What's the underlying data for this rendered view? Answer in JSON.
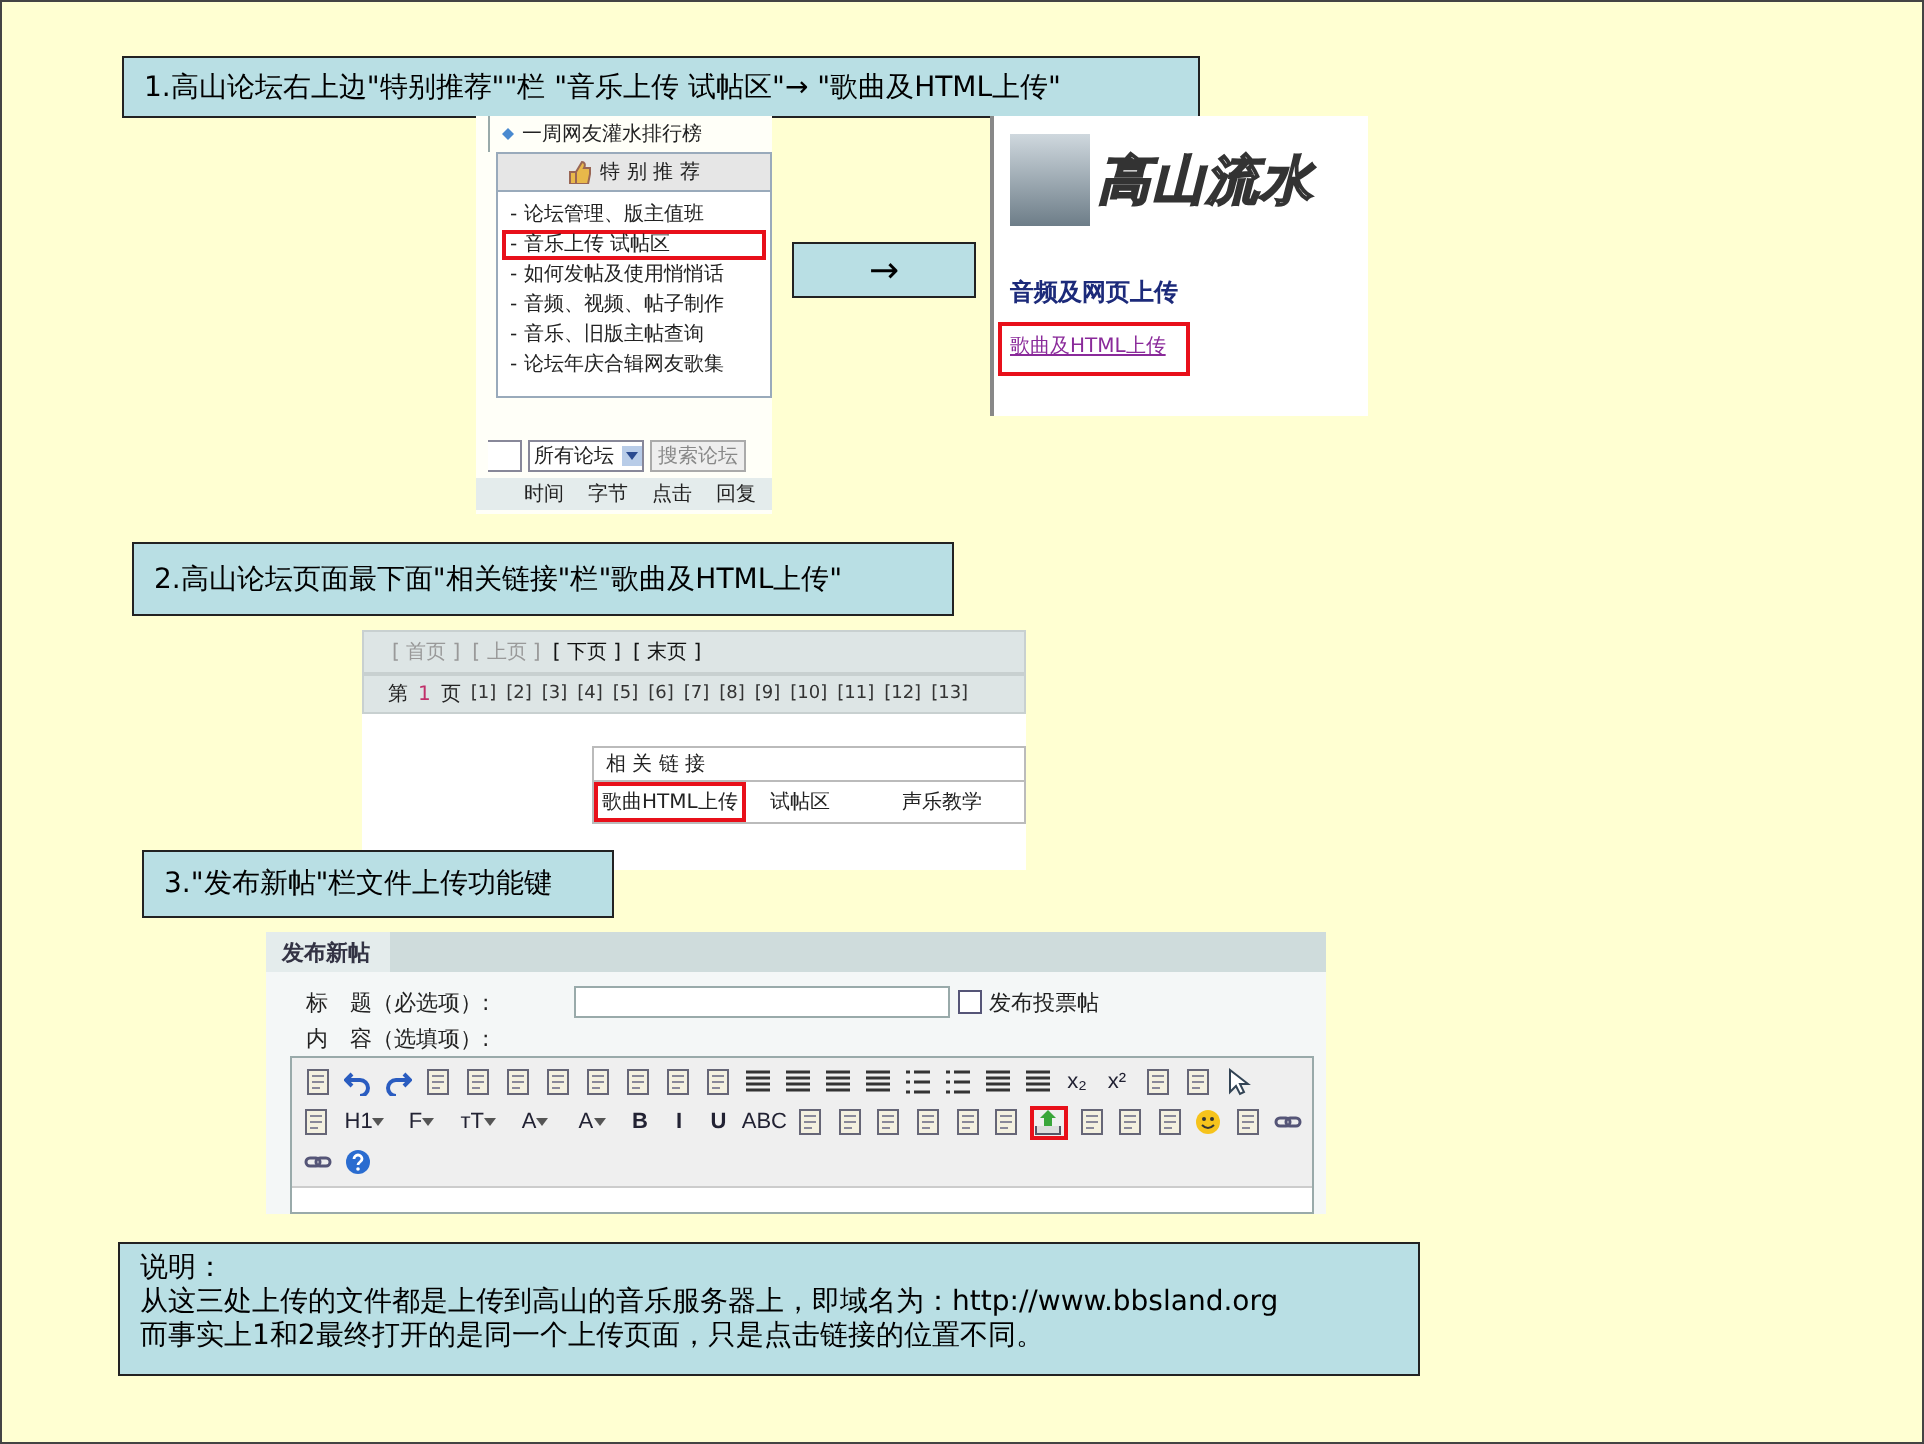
{
  "step_1": {
    "label": "1.高山论坛右上边\"特别推荐\"\"栏 \"音乐上传  试帖区\"→ \"歌曲及HTML上传\""
  },
  "forum_sidebar": {
    "top_item": "一周网友灌水排行榜",
    "panel_title": "特 别 推 荐",
    "links": [
      {
        "label": "- 论坛管理、版主值班",
        "highlighted": false
      },
      {
        "label": "- 音乐上传   试帖区",
        "highlighted": true
      },
      {
        "label": "- 如何发帖及使用悄悄话",
        "highlighted": false
      },
      {
        "label": "- 音频、视频、帖子制作",
        "highlighted": false
      },
      {
        "label": "- 音乐、旧版主帖查询",
        "highlighted": false
      },
      {
        "label": "- 论坛年庆合辑网友歌集",
        "highlighted": false
      }
    ],
    "scope_select": "所有论坛",
    "search_button": "搜索论坛",
    "columns": [
      "时间",
      "字节",
      "点击",
      "回复"
    ]
  },
  "arrow_box": {
    "label": "→"
  },
  "upload_page": {
    "logo": "高山流水",
    "heading": "音频及网页上传",
    "link": {
      "label": "歌曲及HTML上传",
      "highlighted": true
    }
  },
  "step_2": {
    "label": "2.高山论坛页面最下面\"相关链接\"栏\"歌曲及HTML上传\""
  },
  "forum_footer": {
    "nav": [
      {
        "label": "[ 首页 ]",
        "disabled": true
      },
      {
        "label": "[ 上页 ]",
        "disabled": true
      },
      {
        "label": "[ 下页 ]",
        "disabled": false
      },
      {
        "label": "[ 末页 ]",
        "disabled": false
      }
    ],
    "page_prefix": "第",
    "current_page": "1",
    "page_suffix": "页",
    "pages": [
      "[1]",
      "[2]",
      "[3]",
      "[4]",
      "[5]",
      "[6]",
      "[7]",
      "[8]",
      "[9]",
      "[10]",
      "[11]",
      "[12]",
      "[13]"
    ],
    "related_title": "相 关 链 接",
    "related_links": [
      {
        "label": "歌曲HTML上传",
        "highlighted": true
      },
      {
        "label": "试帖区",
        "highlighted": false
      },
      {
        "label": "声乐教学",
        "highlighted": false
      }
    ]
  },
  "step_3": {
    "label": "3.\"发布新帖\"栏文件上传功能键"
  },
  "new_post": {
    "tab": "发布新帖",
    "title_label": "标　题（必选项）:",
    "poll_checkbox": {
      "label": "发布投票帖",
      "checked": false
    },
    "content_label": "内　容（选填项）:",
    "toolbar_rows": [
      [
        {
          "kind": "icon",
          "highlighted": false
        },
        {
          "kind": "undo",
          "highlighted": false
        },
        {
          "kind": "redo",
          "highlighted": false
        },
        {
          "kind": "icon",
          "highlighted": false
        },
        {
          "kind": "icon",
          "highlighted": false
        },
        {
          "kind": "icon",
          "highlighted": false
        },
        {
          "kind": "icon",
          "highlighted": false
        },
        {
          "kind": "icon",
          "highlighted": false
        },
        {
          "kind": "icon",
          "highlighted": false
        },
        {
          "kind": "icon",
          "highlighted": false
        },
        {
          "kind": "icon",
          "highlighted": false
        },
        {
          "kind": "align",
          "highlighted": false
        },
        {
          "kind": "align",
          "highlighted": false
        },
        {
          "kind": "align",
          "highlighted": false
        },
        {
          "kind": "align",
          "highlighted": false
        },
        {
          "kind": "list",
          "highlighted": false
        },
        {
          "kind": "list",
          "highlighted": false
        },
        {
          "kind": "align",
          "highlighted": false
        },
        {
          "kind": "align",
          "highlighted": false
        },
        {
          "kind": "text",
          "label": "x₂",
          "highlighted": false
        },
        {
          "kind": "text",
          "label": "x²",
          "highlighted": false
        },
        {
          "kind": "icon",
          "highlighted": false
        },
        {
          "kind": "icon",
          "highlighted": false
        },
        {
          "kind": "pointer",
          "highlighted": false
        }
      ],
      [
        {
          "kind": "icon",
          "highlighted": false
        },
        {
          "kind": "menu",
          "label": "H1",
          "highlighted": false
        },
        {
          "kind": "menu",
          "label": "F",
          "highlighted": false
        },
        {
          "kind": "menu",
          "label": "тT",
          "highlighted": false
        },
        {
          "kind": "menu",
          "label": "A",
          "highlighted": false
        },
        {
          "kind": "menu",
          "label": "A",
          "highlighted": false
        },
        {
          "kind": "text",
          "label": "B",
          "highlighted": false
        },
        {
          "kind": "text",
          "label": "I",
          "highlighted": false
        },
        {
          "kind": "text",
          "label": "U",
          "highlighted": false
        },
        {
          "kind": "text",
          "label": "ABC",
          "highlighted": false
        },
        {
          "kind": "icon",
          "highlighted": false
        },
        {
          "kind": "icon",
          "highlighted": false
        },
        {
          "kind": "icon",
          "highlighted": false
        },
        {
          "kind": "icon",
          "highlighted": false
        },
        {
          "kind": "icon",
          "highlighted": false
        },
        {
          "kind": "icon",
          "highlighted": false
        },
        {
          "kind": "upload",
          "highlighted": true
        },
        {
          "kind": "icon",
          "highlighted": false
        },
        {
          "kind": "icon",
          "highlighted": false
        },
        {
          "kind": "icon",
          "highlighted": false
        },
        {
          "kind": "smiley",
          "highlighted": false
        },
        {
          "kind": "icon",
          "highlighted": false
        },
        {
          "kind": "link",
          "highlighted": false
        }
      ],
      [
        {
          "kind": "link",
          "highlighted": false
        },
        {
          "kind": "help",
          "highlighted": false
        }
      ]
    ]
  },
  "note": {
    "lines": [
      "说明：",
      "从这三处上传的文件都是上传到高山的音乐服务器上，即域名为：http://www.bbsland.org",
      "而事实上1和2最终打开的是同一个上传页面，只是点击链接的位置不同。"
    ]
  }
}
